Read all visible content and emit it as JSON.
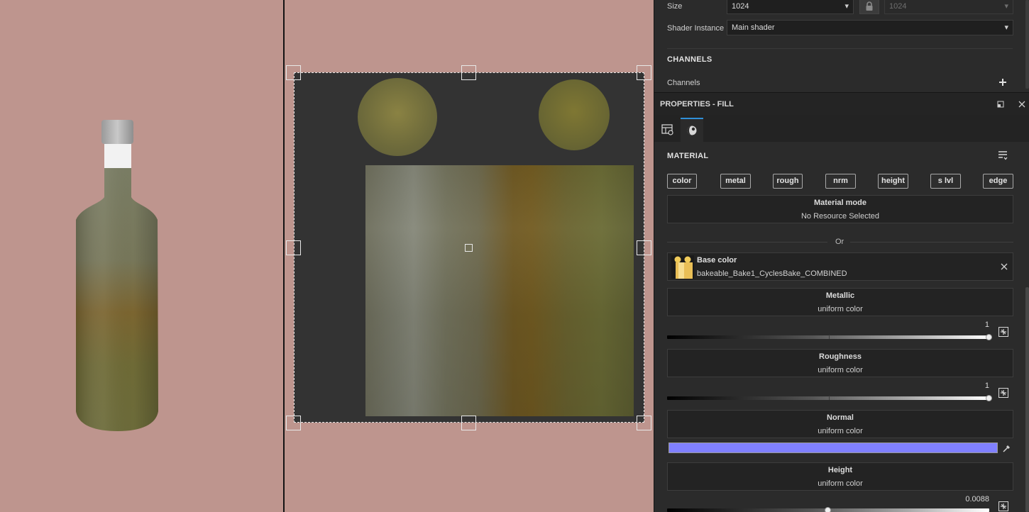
{
  "texture_set": {
    "size_label": "Size",
    "size_value": "1024",
    "size_value_locked": "1024",
    "shader_label": "Shader Instance",
    "shader_value": "Main shader"
  },
  "channels": {
    "title": "CHANNELS",
    "label": "Channels"
  },
  "properties": {
    "title": "PROPERTIES - FILL",
    "tabs": [
      "texture-set-settings-icon",
      "material-icon"
    ]
  },
  "material": {
    "title": "MATERIAL",
    "channel_buttons": [
      "color",
      "metal",
      "rough",
      "nrm",
      "height",
      "s lvl",
      "edge"
    ],
    "mode_title": "Material mode",
    "mode_value": "No Resource Selected",
    "or_label": "Or"
  },
  "base_color": {
    "title": "Base color",
    "resource": "bakeable_Bake1_CyclesBake_COMBINED"
  },
  "metallic": {
    "title": "Metallic",
    "subtitle": "uniform color",
    "value": "1",
    "level": 1.0
  },
  "roughness": {
    "title": "Roughness",
    "subtitle": "uniform color",
    "value": "1",
    "level": 1.0
  },
  "normal": {
    "title": "Normal",
    "subtitle": "uniform color",
    "color": "#8080ff"
  },
  "height": {
    "title": "Height",
    "subtitle": "uniform color",
    "value": "0.0088",
    "level": 0.5
  },
  "colors": {
    "viewport_bg": "#be958e",
    "panel_bg": "#2b2b2b",
    "accent": "#2f8fd8"
  }
}
